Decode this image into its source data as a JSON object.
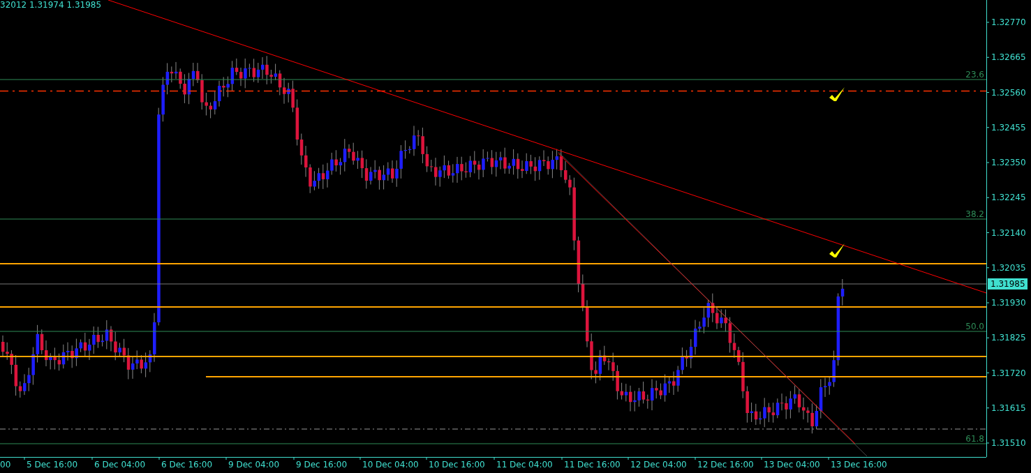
{
  "header": {
    "quote": "32012 1.31974 1.31985"
  },
  "price_axis": {
    "labels": [
      "1.32770",
      "1.32665",
      "1.32560",
      "1.32455",
      "1.32350",
      "1.32245",
      "1.32140",
      "1.32035",
      "1.31930",
      "1.31825",
      "1.31720",
      "1.31615",
      "1.31510"
    ],
    "current_price": "1.31985"
  },
  "time_axis": {
    "labels": [
      "00",
      "5 Dec 16:00",
      "6 Dec 04:00",
      "6 Dec 16:00",
      "9 Dec 04:00",
      "9 Dec 16:00",
      "10 Dec 04:00",
      "10 Dec 16:00",
      "11 Dec 04:00",
      "11 Dec 16:00",
      "12 Dec 04:00",
      "12 Dec 16:00",
      "13 Dec 04:00",
      "13 Dec 16:00"
    ]
  },
  "fibonacci_levels": [
    {
      "label": "23.6"
    },
    {
      "label": "38.2"
    },
    {
      "label": "50.0"
    },
    {
      "label": "61.8"
    }
  ],
  "markers": [
    {
      "kind": "check"
    },
    {
      "kind": "check"
    }
  ]
}
